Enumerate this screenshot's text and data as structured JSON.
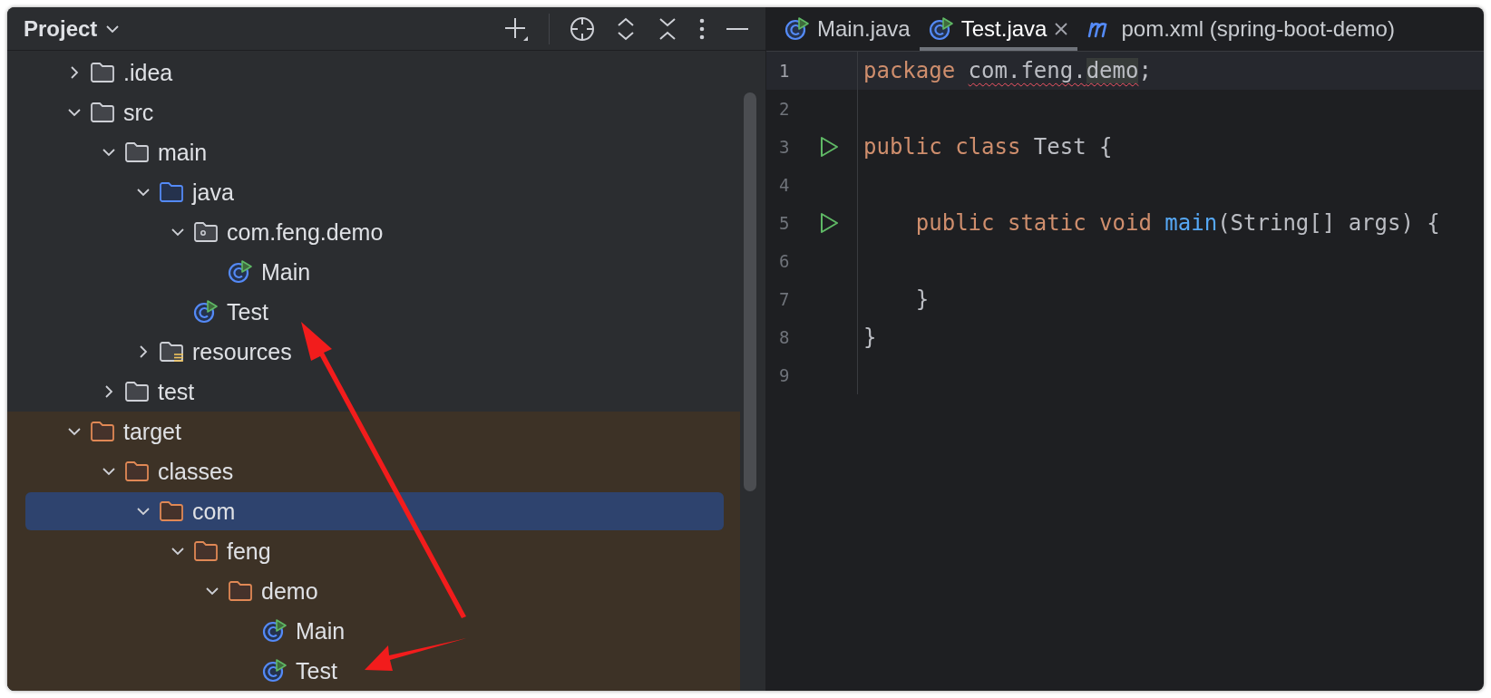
{
  "project_panel": {
    "title": "Project",
    "tree": [
      {
        "label": ".idea",
        "kind": "folder",
        "expanded": false,
        "selected": false
      },
      {
        "label": "src",
        "kind": "folder",
        "expanded": true,
        "selected": false,
        "children": [
          {
            "label": "main",
            "kind": "folder",
            "expanded": true,
            "selected": false,
            "children": [
              {
                "label": "java",
                "kind": "source-folder",
                "expanded": true,
                "selected": false,
                "children": [
                  {
                    "label": "com.feng.demo",
                    "kind": "package",
                    "expanded": true,
                    "selected": false,
                    "children": [
                      {
                        "label": "Main",
                        "kind": "class",
                        "selected": false
                      }
                    ]
                  },
                  {
                    "label": "Test",
                    "kind": "class",
                    "selected": false
                  }
                ]
              },
              {
                "label": "resources",
                "kind": "resources-folder",
                "expanded": false,
                "selected": false
              }
            ]
          },
          {
            "label": "test",
            "kind": "folder",
            "expanded": false,
            "selected": false
          }
        ]
      },
      {
        "label": "target",
        "kind": "excluded-folder",
        "expanded": true,
        "selected": false,
        "children": [
          {
            "label": "classes",
            "kind": "excluded-folder",
            "expanded": true,
            "selected": false,
            "children": [
              {
                "label": "com",
                "kind": "excluded-folder",
                "expanded": true,
                "selected": true,
                "children": [
                  {
                    "label": "feng",
                    "kind": "excluded-folder",
                    "expanded": true,
                    "selected": false,
                    "children": [
                      {
                        "label": "demo",
                        "kind": "excluded-folder",
                        "expanded": true,
                        "selected": false,
                        "children": [
                          {
                            "label": "Main",
                            "kind": "class",
                            "selected": false
                          },
                          {
                            "label": "Test",
                            "kind": "class",
                            "selected": false
                          }
                        ]
                      }
                    ]
                  }
                ]
              }
            ]
          }
        ]
      }
    ]
  },
  "tabs": [
    {
      "label": "Main.java",
      "kind": "class",
      "selected": false,
      "closable": false
    },
    {
      "label": "Test.java",
      "kind": "class",
      "selected": true,
      "closable": true
    },
    {
      "label": "pom.xml (spring-boot-demo)",
      "kind": "maven",
      "selected": false,
      "closable": false
    }
  ],
  "editor": {
    "lines": [
      {
        "number": "1",
        "run": false,
        "current": true,
        "tokens": [
          {
            "text": "package ",
            "kind": "keyword"
          },
          {
            "text": "com.feng.",
            "kind": "error"
          },
          {
            "text": "demo",
            "kind": "error-highlight"
          },
          {
            "text": ";",
            "kind": "plain"
          }
        ]
      },
      {
        "number": "2",
        "run": false,
        "current": false
      },
      {
        "number": "3",
        "run": true,
        "current": false,
        "tokens": [
          {
            "text": "public class ",
            "kind": "keyword"
          },
          {
            "text": "Test {",
            "kind": "plain"
          }
        ]
      },
      {
        "number": "4",
        "run": false,
        "current": false
      },
      {
        "number": "5",
        "run": true,
        "current": false,
        "tokens": [
          {
            "text": "    public static void ",
            "kind": "keyword"
          },
          {
            "text": "main",
            "kind": "function"
          },
          {
            "text": "(String[] args) {",
            "kind": "plain"
          }
        ]
      },
      {
        "number": "6",
        "run": false,
        "current": false
      },
      {
        "number": "7",
        "run": false,
        "current": false,
        "tokens": [
          {
            "text": "    }",
            "kind": "plain"
          }
        ]
      },
      {
        "number": "8",
        "run": false,
        "current": false,
        "tokens": [
          {
            "text": "}",
            "kind": "plain"
          }
        ]
      },
      {
        "number": "9",
        "run": false,
        "current": false
      }
    ]
  }
}
